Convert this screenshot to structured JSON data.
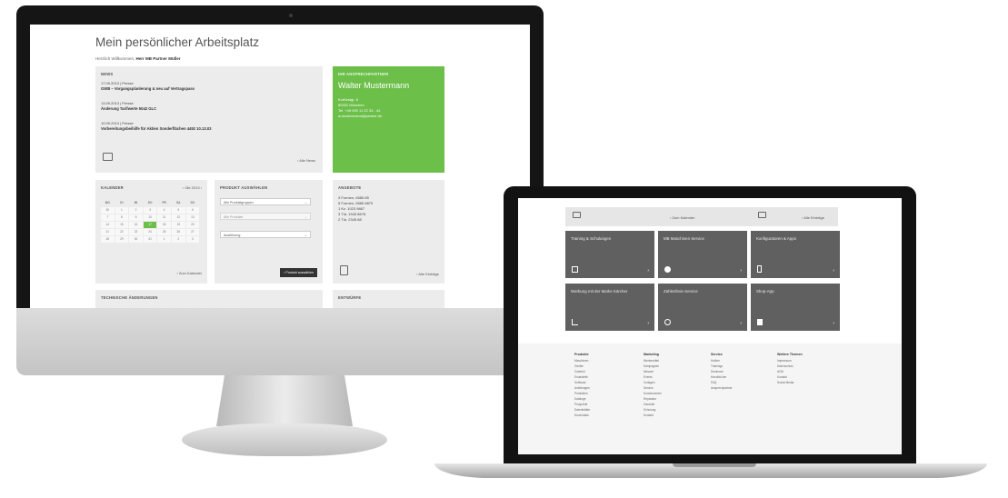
{
  "workspace": {
    "title": "Mein persönlicher Arbeitsplatz",
    "welcome_prefix": "Herzlich Willkommen,",
    "welcome_name": "Herr MB Partner Müller",
    "news": {
      "heading": "NEWS",
      "items": [
        {
          "date": "17.09.2013 | Presse",
          "text": "GWB – Vorgangsplanlerung & neu auf Vertragspass"
        },
        {
          "date": "13.09.2013 | Presse",
          "text": "Änderung Tarifwerte 5042 GLC"
        },
        {
          "date": "10.09.2013 | Presse",
          "text": "Vorbereitungsbeihilfe für Aktien Sonderflächen 4492 10.13.03"
        }
      ],
      "all_link": "Alle News"
    },
    "contact": {
      "heading": "IHR ANSPRECHPARTNER",
      "name": "Walter Mustermann",
      "lines": [
        "Kurfürstgr. 8",
        "80331 München",
        "Tel. +49 000 11 22 33 - 44",
        "w.mustermann@partner.de"
      ]
    },
    "calendar": {
      "heading": "KALENDER",
      "month": "‹ Okt 2013 ›",
      "weekdays": [
        "MO",
        "DI",
        "MI",
        "DO",
        "FR",
        "SA",
        "SO"
      ],
      "days": [
        "30",
        "1",
        "2",
        "3",
        "4",
        "5",
        "6",
        "7",
        "8",
        "9",
        "10",
        "11",
        "12",
        "13",
        "14",
        "15",
        "16",
        "17",
        "18",
        "19",
        "20",
        "21",
        "22",
        "23",
        "24",
        "25",
        "26",
        "27",
        "28",
        "29",
        "30",
        "31",
        "1",
        "2",
        "3"
      ],
      "selected_index": 17,
      "link": "Zum Kalender"
    },
    "product": {
      "heading": "PRODUKT AUSWÄHLEN",
      "selects": [
        "Alle Produktgruppen",
        "Alle Produkte",
        "Ausführung"
      ],
      "button": "Produkt auswählen"
    },
    "orders": {
      "heading": "ANGEBOTE",
      "items": [
        "3 Formen, 6585 85",
        "5 Formen, 6585 8870",
        "1 Kz. 1023 9887",
        "3 Tür, 1545 8678",
        "2 Tür, 2345 88"
      ],
      "link": "Alle Einträge"
    },
    "bottom_left_heading": "TECHNISCHE ÄNDERUNGEN",
    "bottom_right_heading": "ENTWÜRFE"
  },
  "laptop": {
    "top_left_link": "Zum Kalender",
    "top_right_link": "Alle Einträge",
    "tiles": [
      {
        "label": "Training & Schulungen",
        "icon": "monitor-icon"
      },
      {
        "label": "MB Maschinen Service",
        "icon": "disc-icon"
      },
      {
        "label": "Konfiguratoren & Apps",
        "icon": "phone-icon"
      },
      {
        "label": "Werbung mit der Marke Kärcher",
        "icon": "chart-icon"
      },
      {
        "label": "Zahlenfreie Service",
        "icon": "people-icon"
      },
      {
        "label": "Shop-App",
        "icon": "bag-icon"
      }
    ],
    "footer": [
      {
        "heading": "Produkte",
        "items": [
          "Maschinen",
          "Geräte",
          "Zubehör",
          "Ersatzteile",
          "Software",
          "Anleitungen",
          "Preislisten",
          "Kataloge",
          "Prospekte",
          "Datenblätter",
          "Downloads"
        ]
      },
      {
        "heading": "Marketing",
        "items": [
          "Werbemittel",
          "Kampagnen",
          "Messen",
          "Events",
          "Vorlagen",
          "Service",
          "Kundencenter",
          "Reparatur",
          "Garantie",
          "Schulung",
          "Kontakt"
        ]
      },
      {
        "heading": "Service",
        "items": [
          "Hotline",
          "Trainings",
          "Seminare",
          "Handbücher",
          "FAQ",
          "Ansprechpartner"
        ]
      },
      {
        "heading": "Weitere Themen",
        "items": [
          "Impressum",
          "Datenschutz",
          "AGB",
          "Kontakt",
          "Social Media"
        ]
      }
    ]
  }
}
